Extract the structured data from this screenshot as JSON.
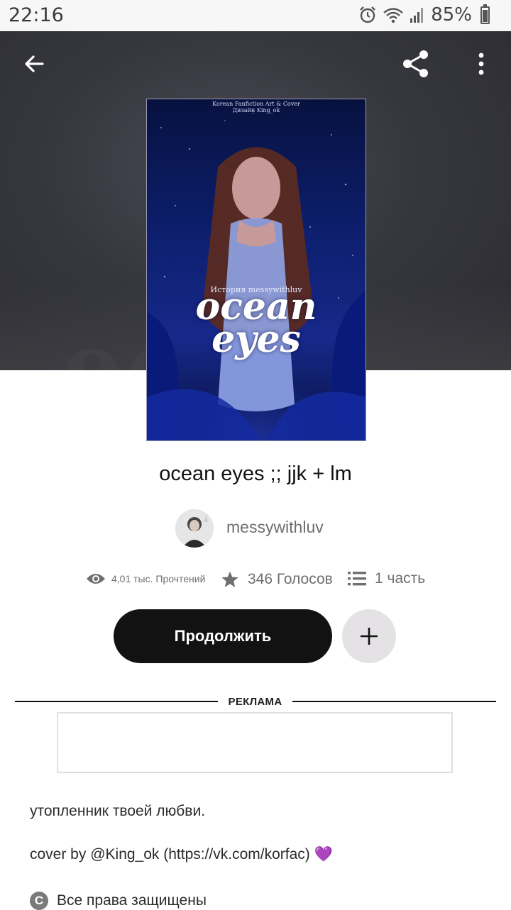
{
  "status_bar": {
    "time": "22:16",
    "battery": "85%",
    "icons": [
      "alarm-icon",
      "wifi-icon",
      "signal-icon",
      "battery-icon"
    ]
  },
  "toolbar": {
    "back_icon": "arrow-left-icon",
    "share_icon": "share-icon",
    "more_icon": "more-vertical-icon"
  },
  "cover": {
    "credit_line_1": "Korean Fanfiction Art & Cover",
    "credit_line_2": "Дизайн King_ok",
    "author_line": "История messywithluv",
    "title_line_1": "ocean",
    "title_line_2": "eyes"
  },
  "story": {
    "title": "ocean eyes ;; jjk + lm",
    "author": "messywithluv"
  },
  "stats": {
    "reads": "4,01 тыс. Прочтений",
    "votes": "346 Голосов",
    "parts": "1 часть"
  },
  "actions": {
    "continue_label": "Продолжить",
    "add_icon": "plus-icon"
  },
  "ad": {
    "label": "РЕКЛАМА"
  },
  "description": {
    "line_1": "утопленник твоей любви.",
    "line_2": "cover by @King_ok (https://vk.com/korfac)",
    "line_2_emoji": "💜"
  },
  "rights": {
    "icon_letter": "C",
    "text": "Все права защищены"
  },
  "colors": {
    "primary_button": "#121212",
    "secondary_button": "#e4e2e4",
    "muted_text": "#6f6f6f",
    "heart": "#a334e6"
  }
}
